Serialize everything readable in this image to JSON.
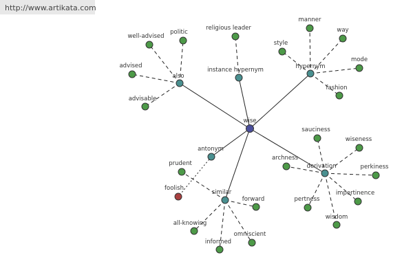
{
  "banner": {
    "url": "http://www.artikata.com"
  },
  "colors": {
    "center": "#4b4f9c",
    "relation": "#4a9090",
    "word": "#4d9a48",
    "antonym_word": "#a94040",
    "edge": "#222222"
  },
  "graph": {
    "nodes": [
      {
        "id": "wise",
        "label": "wise",
        "kind": "center"
      },
      {
        "id": "also",
        "label": "also",
        "kind": "relation"
      },
      {
        "id": "instance_hypernym",
        "label": "instance hypernym",
        "kind": "relation"
      },
      {
        "id": "hypernym",
        "label": "hypernym",
        "kind": "relation"
      },
      {
        "id": "antonym",
        "label": "antonym",
        "kind": "relation"
      },
      {
        "id": "similar",
        "label": "similar",
        "kind": "relation"
      },
      {
        "id": "derivation",
        "label": "derivation",
        "kind": "relation"
      },
      {
        "id": "well_advised",
        "label": "well-advised",
        "kind": "word"
      },
      {
        "id": "politic",
        "label": "politic",
        "kind": "word"
      },
      {
        "id": "advised",
        "label": "advised",
        "kind": "word"
      },
      {
        "id": "advisable",
        "label": "advisable",
        "kind": "word"
      },
      {
        "id": "religious_leader",
        "label": "religious leader",
        "kind": "word"
      },
      {
        "id": "manner",
        "label": "manner",
        "kind": "word"
      },
      {
        "id": "way",
        "label": "way",
        "kind": "word"
      },
      {
        "id": "style",
        "label": "style",
        "kind": "word"
      },
      {
        "id": "mode",
        "label": "mode",
        "kind": "word"
      },
      {
        "id": "fashion",
        "label": "fashion",
        "kind": "word"
      },
      {
        "id": "sauciness",
        "label": "sauciness",
        "kind": "word"
      },
      {
        "id": "wiseness",
        "label": "wiseness",
        "kind": "word"
      },
      {
        "id": "archness",
        "label": "archness",
        "kind": "word"
      },
      {
        "id": "perkiness",
        "label": "perkiness",
        "kind": "word"
      },
      {
        "id": "impertinence",
        "label": "impertinence",
        "kind": "word"
      },
      {
        "id": "pertness",
        "label": "pertness",
        "kind": "word"
      },
      {
        "id": "wisdom",
        "label": "wisdom",
        "kind": "word"
      },
      {
        "id": "prudent",
        "label": "prudent",
        "kind": "word"
      },
      {
        "id": "foolish",
        "label": "foolish",
        "kind": "antonym_word"
      },
      {
        "id": "forward",
        "label": "forward",
        "kind": "word"
      },
      {
        "id": "all_knowing",
        "label": "all-knowing",
        "kind": "word"
      },
      {
        "id": "informed",
        "label": "informed",
        "kind": "word"
      },
      {
        "id": "omniscient",
        "label": "omniscient",
        "kind": "word"
      }
    ],
    "edges": [
      {
        "from": "wise",
        "to": "also",
        "style": "solid"
      },
      {
        "from": "wise",
        "to": "instance_hypernym",
        "style": "solid"
      },
      {
        "from": "wise",
        "to": "hypernym",
        "style": "solid"
      },
      {
        "from": "wise",
        "to": "antonym",
        "style": "solid"
      },
      {
        "from": "wise",
        "to": "similar",
        "style": "solid"
      },
      {
        "from": "wise",
        "to": "derivation",
        "style": "solid"
      },
      {
        "from": "also",
        "to": "well_advised",
        "style": "dashed"
      },
      {
        "from": "also",
        "to": "politic",
        "style": "dashed"
      },
      {
        "from": "also",
        "to": "advised",
        "style": "dashed"
      },
      {
        "from": "also",
        "to": "advisable",
        "style": "dashed"
      },
      {
        "from": "instance_hypernym",
        "to": "religious_leader",
        "style": "dashed"
      },
      {
        "from": "hypernym",
        "to": "manner",
        "style": "dashed"
      },
      {
        "from": "hypernym",
        "to": "way",
        "style": "dashed"
      },
      {
        "from": "hypernym",
        "to": "style",
        "style": "dashed"
      },
      {
        "from": "hypernym",
        "to": "mode",
        "style": "dashed"
      },
      {
        "from": "hypernym",
        "to": "fashion",
        "style": "dashed"
      },
      {
        "from": "derivation",
        "to": "sauciness",
        "style": "dashed"
      },
      {
        "from": "derivation",
        "to": "wiseness",
        "style": "dashed"
      },
      {
        "from": "derivation",
        "to": "archness",
        "style": "dashed"
      },
      {
        "from": "derivation",
        "to": "perkiness",
        "style": "dashed"
      },
      {
        "from": "derivation",
        "to": "impertinence",
        "style": "dashed"
      },
      {
        "from": "derivation",
        "to": "pertness",
        "style": "dashed"
      },
      {
        "from": "derivation",
        "to": "wisdom",
        "style": "dashed"
      },
      {
        "from": "antonym",
        "to": "foolish",
        "style": "dotted"
      },
      {
        "from": "similar",
        "to": "prudent",
        "style": "dashed"
      },
      {
        "from": "similar",
        "to": "forward",
        "style": "dashed"
      },
      {
        "from": "similar",
        "to": "all_knowing",
        "style": "dashed"
      },
      {
        "from": "similar",
        "to": "informed",
        "style": "dashed"
      },
      {
        "from": "similar",
        "to": "omniscient",
        "style": "dashed"
      }
    ]
  }
}
